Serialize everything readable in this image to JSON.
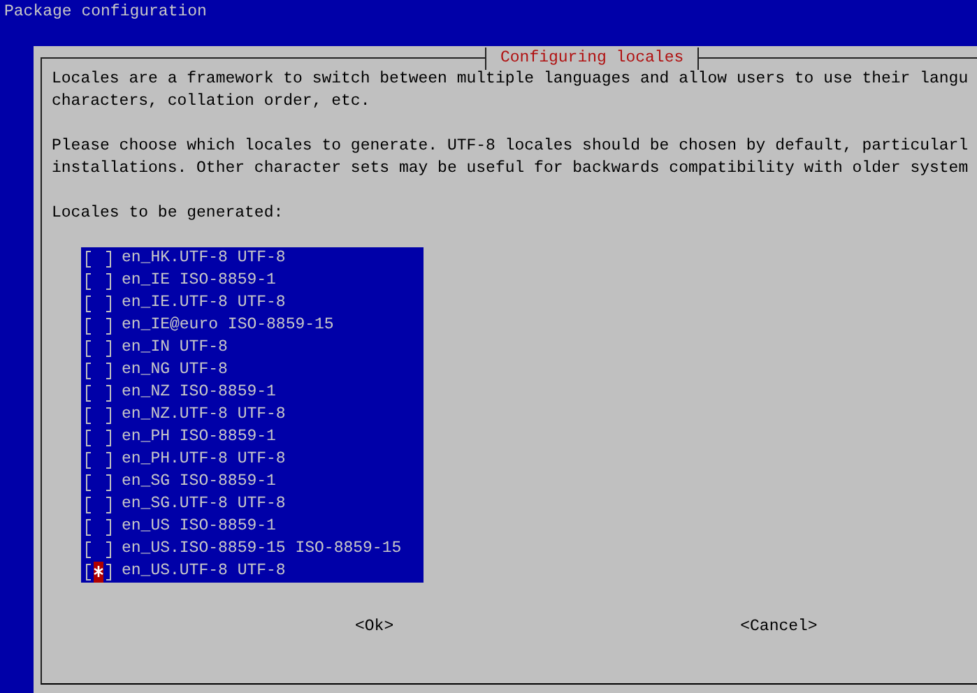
{
  "window": {
    "title": "Package configuration"
  },
  "dialog": {
    "title": "Configuring locales",
    "paragraphs": [
      [
        "Locales are a framework to switch between multiple languages and allow users to use their langu",
        "characters, collation order, etc."
      ],
      [
        "Please choose which locales to generate. UTF-8 locales should be chosen by default, particularl",
        "installations. Other character sets may be useful for backwards compatibility with older system"
      ]
    ],
    "list_label": "Locales to be generated:",
    "locales": [
      {
        "label": "en_HK.UTF-8 UTF-8",
        "checked": false,
        "selected": false
      },
      {
        "label": "en_IE ISO-8859-1",
        "checked": false,
        "selected": false
      },
      {
        "label": "en_IE.UTF-8 UTF-8",
        "checked": false,
        "selected": false
      },
      {
        "label": "en_IE@euro ISO-8859-15",
        "checked": false,
        "selected": false
      },
      {
        "label": "en_IN UTF-8",
        "checked": false,
        "selected": false
      },
      {
        "label": "en_NG UTF-8",
        "checked": false,
        "selected": false
      },
      {
        "label": "en_NZ ISO-8859-1",
        "checked": false,
        "selected": false
      },
      {
        "label": "en_NZ.UTF-8 UTF-8",
        "checked": false,
        "selected": false
      },
      {
        "label": "en_PH ISO-8859-1",
        "checked": false,
        "selected": false
      },
      {
        "label": "en_PH.UTF-8 UTF-8",
        "checked": false,
        "selected": false
      },
      {
        "label": "en_SG ISO-8859-1",
        "checked": false,
        "selected": false
      },
      {
        "label": "en_SG.UTF-8 UTF-8",
        "checked": false,
        "selected": false
      },
      {
        "label": "en_US ISO-8859-1",
        "checked": false,
        "selected": false
      },
      {
        "label": "en_US.ISO-8859-15 ISO-8859-15",
        "checked": false,
        "selected": false
      },
      {
        "label": "en_US.UTF-8 UTF-8",
        "checked": true,
        "selected": true
      }
    ],
    "buttons": [
      {
        "label": "<Ok>",
        "selected": false
      },
      {
        "label": "<Cancel>",
        "selected": false
      }
    ]
  }
}
